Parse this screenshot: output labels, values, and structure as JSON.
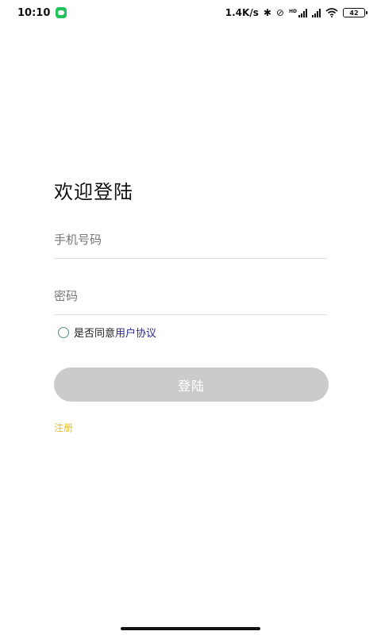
{
  "status_bar": {
    "time": "10:10",
    "network_speed": "1.4K/s",
    "battery": "42",
    "signal_hd": "HD",
    "icons": [
      "wechat-icon",
      "bluetooth-icon",
      "mute-icon",
      "signal-icon",
      "wifi-icon",
      "battery-icon"
    ]
  },
  "login": {
    "title": "欢迎登陆",
    "phone_placeholder": "手机号码",
    "phone_value": "",
    "password_placeholder": "密码",
    "password_value": "",
    "agree_text": "是否同意",
    "agreement_link": "用户协议",
    "agree_checked": false,
    "login_button": "登陆",
    "register_link": "注册"
  },
  "colors": {
    "button_disabled": "#cbcbcb",
    "link_blue": "#2a2a8a",
    "register_yellow": "#e6c12a",
    "radio_border": "#5a8f86"
  }
}
